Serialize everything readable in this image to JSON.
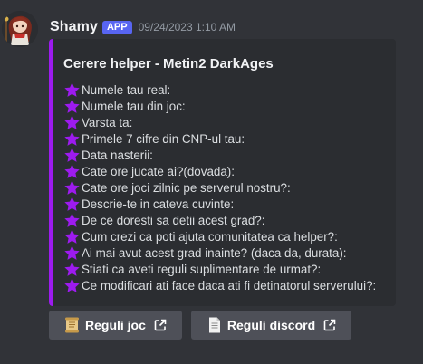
{
  "message": {
    "username": "Shamy",
    "badge": "APP",
    "timestamp": "09/24/2023 1:10 AM"
  },
  "embed": {
    "accent_color": "#9d1bef",
    "title": "Cerere helper - Metin2 DarkAges",
    "field_icon": "purple-star-icon",
    "fields": [
      "Numele tau real:",
      "Numele tau din joc:",
      "Varsta ta:",
      "Primele 7 cifre din CNP-ul tau:",
      "Data nasterii:",
      "Cate ore jucate ai?(dovada):",
      "Cate ore joci zilnic pe serverul nostru?:",
      "Descrie-te in cateva cuvinte:",
      "De ce doresti sa detii acest grad?:",
      "Cum crezi ca poti ajuta comunitatea ca helper?:",
      "Ai mai avut acest grad inainte? (daca da, durata):",
      "Stiati ca aveti reguli suplimentare de urmat?:",
      "Ce modificari ati face daca ati fi detinatorul serverului?:"
    ]
  },
  "buttons": [
    {
      "label": "Reguli joc",
      "icon": "scroll-icon"
    },
    {
      "label": "Reguli discord",
      "icon": "page-icon"
    }
  ],
  "colors": {
    "background": "#313338",
    "embed_background": "#2b2d31",
    "button_background": "#4e5058",
    "app_badge": "#5865f2",
    "star": "#9d1bef"
  }
}
